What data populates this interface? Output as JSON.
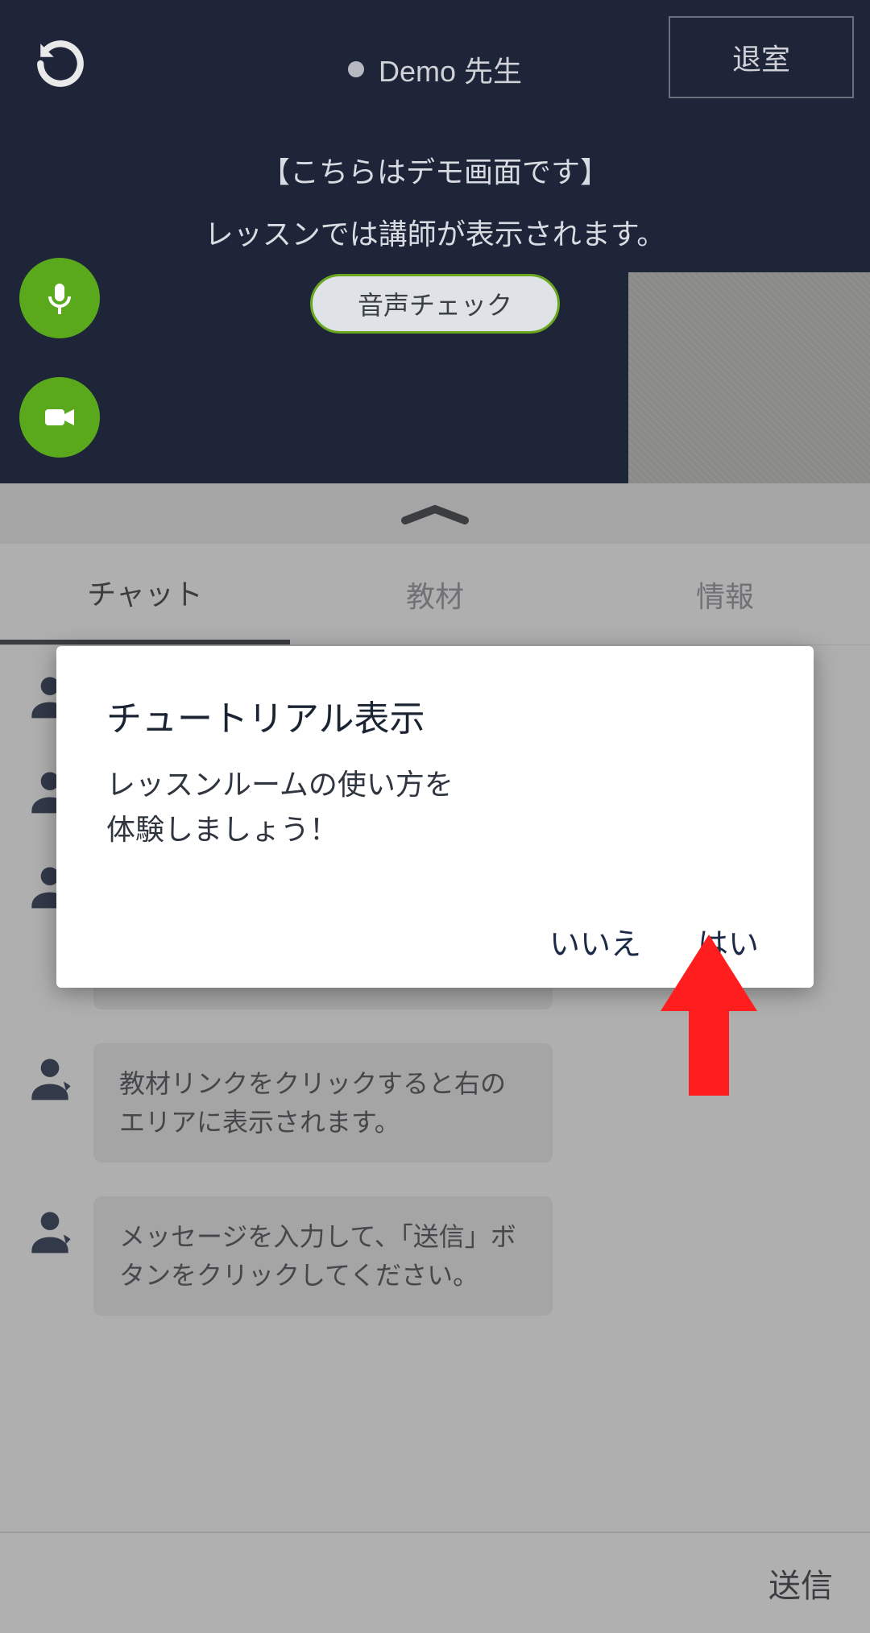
{
  "header": {
    "teacher_name": "Demo 先生",
    "exit_label": "退室",
    "demo_banner_line1": "【こちらはデモ画面です】",
    "demo_banner_line2": "レッスンでは講師が表示されます。",
    "audio_check_label": "音声チェック"
  },
  "tabs": {
    "chat": "チャット",
    "material": "教材",
    "info": "情報"
  },
  "chat": {
    "messages": [
      {
        "text": ""
      },
      {
        "text": ""
      },
      {
        "link": "https://www.rarejob.com/lesson/material/jitsuyo/starter/regular/greetings/"
      },
      {
        "text": "教材リンクをクリックすると右のエリアに表示されます。"
      },
      {
        "text": "メッセージを入力して、「送信」ボタンをクリックしてください。"
      }
    ]
  },
  "footer": {
    "send_label": "送信",
    "input_placeholder": ""
  },
  "modal": {
    "title": "チュートリアル表示",
    "body_line1": "レッスンルームの使い方を",
    "body_line2": "体験しましょう！",
    "no_label": "いいえ",
    "yes_label": "はい"
  },
  "colors": {
    "dark_bg": "#1e2539",
    "accent_green": "#5aa81b",
    "arrow_red": "#ff1d1d"
  }
}
